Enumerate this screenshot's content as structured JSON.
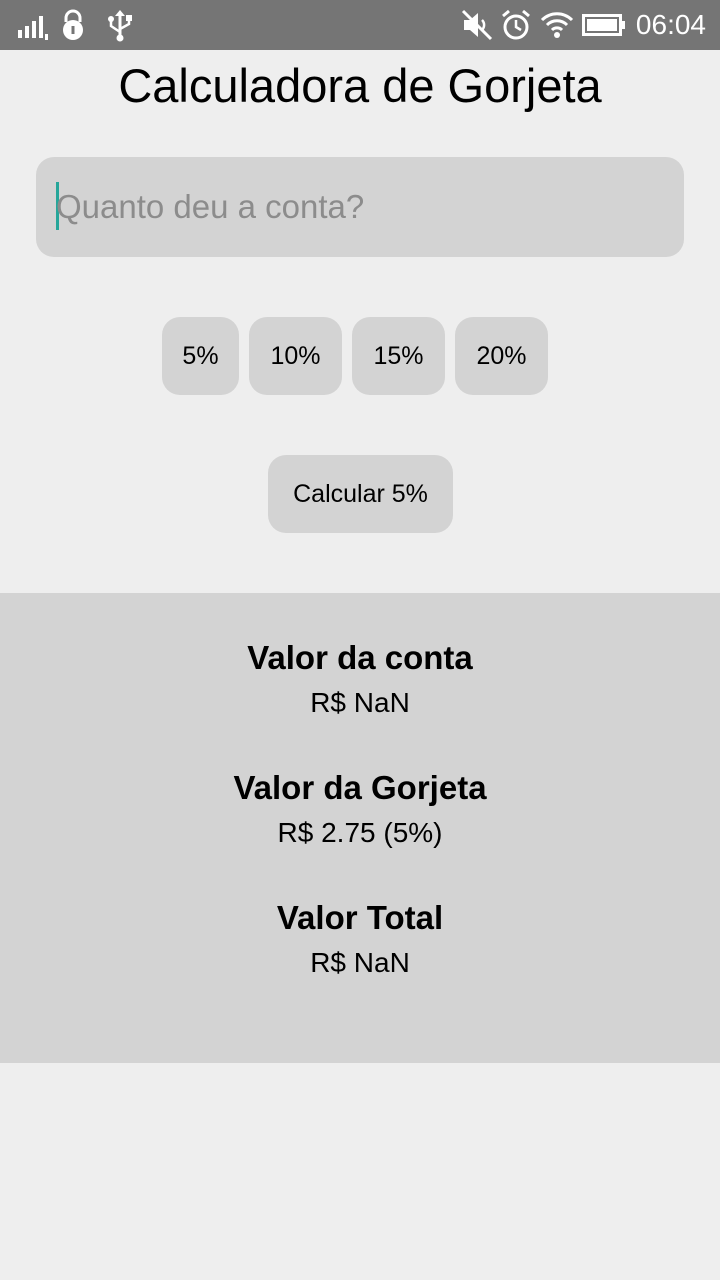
{
  "status_bar": {
    "time": "06:04",
    "icons": [
      "signal-icon",
      "lock-icon",
      "usb-icon",
      "mute-icon",
      "alarm-icon",
      "wifi-icon",
      "battery-icon"
    ]
  },
  "app": {
    "title": "Calculadora de Gorjeta"
  },
  "bill_input": {
    "value": "",
    "placeholder": "Quanto deu a conta?"
  },
  "tip_options": [
    "5%",
    "10%",
    "15%",
    "20%"
  ],
  "calculate_button": {
    "label": "Calcular 5%"
  },
  "results": {
    "bill": {
      "label": "Valor da conta",
      "value": "R$ NaN"
    },
    "tip": {
      "label": "Valor da Gorjeta",
      "value": "R$ 2.75 (5%)"
    },
    "total": {
      "label": "Valor Total",
      "value": "R$ NaN"
    }
  },
  "colors": {
    "status_bar": "#757575",
    "background": "#eeeeee",
    "button_bg": "#d3d3d3",
    "caret": "#26a69a"
  }
}
